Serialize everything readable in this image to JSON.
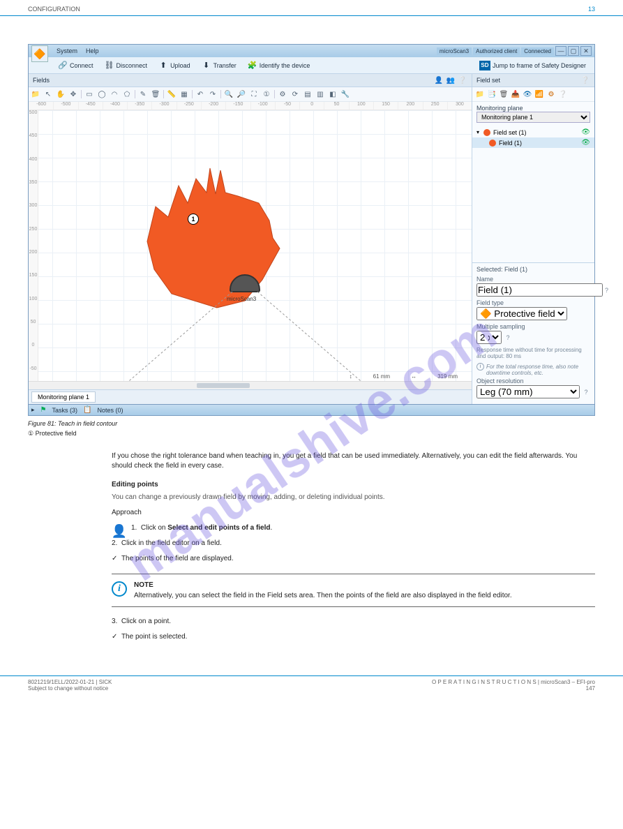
{
  "doc_header": {
    "left": "CONFIGURATION",
    "right": "13",
    "right_num": "13"
  },
  "window": {
    "menu": {
      "system": "System",
      "help": "Help"
    },
    "status": {
      "device": "microScan3",
      "auth": "Authorized client",
      "conn": "Connected"
    },
    "win_btns": {
      "min": "—",
      "max": "▢",
      "close": "✕"
    }
  },
  "toolbar": {
    "connect": "Connect",
    "disconnect": "Disconnect",
    "upload": "Upload",
    "transfer": "Transfer",
    "identify": "Identify the device",
    "sd_label": "Jump to frame of Safety Designer",
    "sd_icon": "SD"
  },
  "main_panel_title": "Fields",
  "canvas": {
    "h_ticks": [
      "-600",
      "-500",
      "-450",
      "-400",
      "-350",
      "-300",
      "-250",
      "-200",
      "-150",
      "-100",
      "-50",
      "0",
      "50",
      "100",
      "150",
      "200",
      "250",
      "300"
    ],
    "v_ticks": [
      "-50",
      "0",
      "50",
      "100",
      "150",
      "200",
      "250",
      "300",
      "350",
      "400",
      "450",
      "500"
    ],
    "scanner_label": "microScan3",
    "marker_num": "1",
    "dim1": "61 mm",
    "dim2": "319 mm"
  },
  "bottom_tab": "Monitoring plane 1",
  "side": {
    "title": "Field set",
    "mon_label": "Monitoring plane",
    "mon_value": "Monitoring plane 1",
    "tree_fs": "Field set (1)",
    "tree_f": "Field (1)"
  },
  "props": {
    "selected_label": "Selected:",
    "selected_value": "Field (1)",
    "name_label": "Name",
    "name_value": "Field (1)",
    "ftype_label": "Field type",
    "ftype_value": "Protective field",
    "ms_label": "Multiple sampling",
    "ms_value": "2 x",
    "rt_text": "Response time without time for processing and output: 80 ms",
    "rt_note": "For the total response time, also note downtime controls, etc.",
    "or_label": "Object resolution",
    "or_value": "Leg (70 mm)"
  },
  "statusbar": {
    "tasks": "Tasks (3)",
    "notes": "Notes (0)"
  },
  "figure": {
    "caption": "Figure 81: Teach in field contour",
    "legend": "①  Protective field"
  },
  "body": {
    "p1": "If you chose the right tolerance band when teaching in, you get a field that can be used immediately. Alternatively, you can edit the field afterwards. You should check the field in every case.",
    "h1": "Editing points",
    "lead": "You can change a previously drawn field by moving, adding, or deleting individual points.",
    "approach": "Approach",
    "step1_a": "Click on ",
    "step1_b": "Select and edit points of a field",
    "step1_c": ".",
    "step2": "Click in the field editor on a field.",
    "res2": "The points of the field are displayed.",
    "note_title": "NOTE",
    "note_body": "Alternatively, you can select the field in the Field sets area. Then the points of the field are also displayed in the field editor.",
    "step3": "Click on a point.",
    "res3": "The point is selected."
  },
  "footer": {
    "left": "8021219/1ELL/2022-01-21 | SICK",
    "sub": "Subject to change without notice",
    "right_a": "O P E R A T I N G   I N S T R U C T I O N S | microScan3 – EFI-pro",
    "right_b": "147"
  },
  "watermark": "manualshive.com"
}
